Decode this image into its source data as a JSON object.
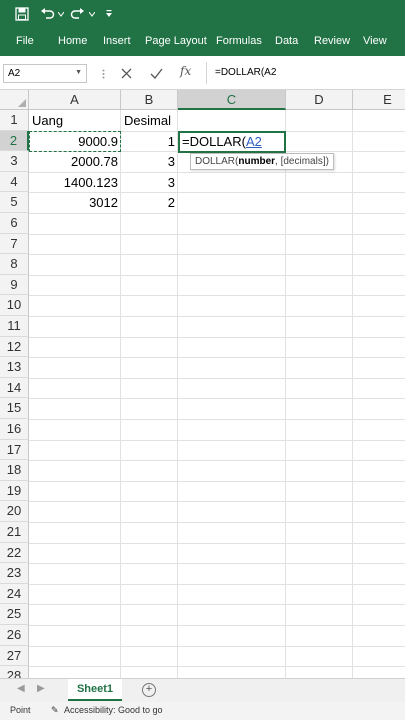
{
  "qat": {
    "icons": [
      "save-icon",
      "undo-icon",
      "redo-icon",
      "customize-icon"
    ],
    "bg_color": "#217346"
  },
  "ribbon": {
    "tabs": [
      "File",
      "Home",
      "Insert",
      "Page Layout",
      "Formulas",
      "Data",
      "Review",
      "View"
    ]
  },
  "formula_bar": {
    "name_box": "A2",
    "formula": "=DOLLAR(A2"
  },
  "grid": {
    "columns": [
      "A",
      "B",
      "C",
      "D",
      "E"
    ],
    "selected_column": "C",
    "rows": [
      "1",
      "2",
      "3",
      "4",
      "5",
      "6",
      "7",
      "8",
      "9",
      "10",
      "11",
      "12",
      "13",
      "14",
      "15",
      "16",
      "17",
      "18",
      "19",
      "20",
      "21",
      "22",
      "23",
      "24",
      "25",
      "26",
      "27",
      "28"
    ],
    "selected_row": "2",
    "cells": {
      "A1": "Uang",
      "B1": "Desimal",
      "A2": "9000.9",
      "B2": "1",
      "A3": "2000.78",
      "B3": "3",
      "A4": "1400.123",
      "B4": "3",
      "A5": "3012",
      "B5": "2"
    },
    "editing": {
      "prefix": "=DOLLAR(",
      "ref": "A2"
    },
    "tooltip": {
      "fn": "DOLLAR(",
      "arg1": "number",
      "rest": ", [decimals])"
    }
  },
  "sheets": {
    "tabs": [
      "Sheet1"
    ],
    "add_label": "+"
  },
  "status": {
    "mode": "Point",
    "accessibility": "Accessibility: Good to go"
  },
  "colors": {
    "accent": "#217346",
    "ref_blue": "#2f5fbf"
  }
}
